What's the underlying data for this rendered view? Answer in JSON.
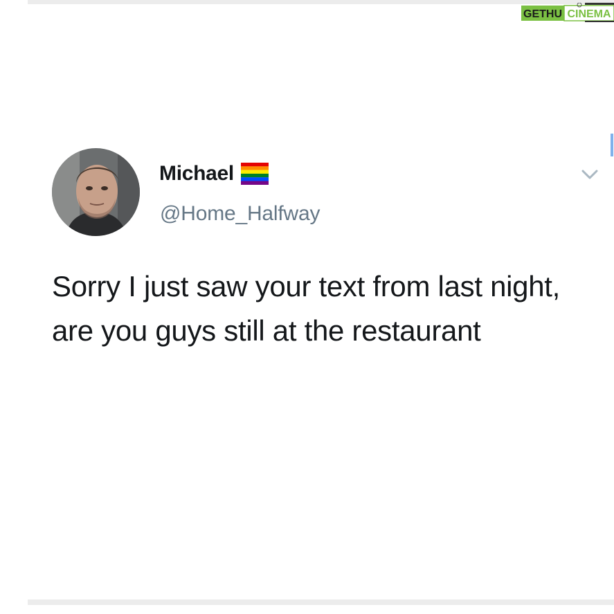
{
  "watermark": {
    "brand_left": "GETHU",
    "brand_right": "CINEMA",
    "color_left": "#7bc043",
    "color_right": "#7bc043"
  },
  "tweet": {
    "display_name": "Michael",
    "name_emoji": "rainbow-flag-icon",
    "handle": "@Home_Halfway",
    "text": "Sorry I just saw your text from last night, are you guys still at the restaurant",
    "menu_icon": "chevron-down-icon"
  },
  "colors": {
    "name": "#14171a",
    "handle": "#657786",
    "caret": "#aab8c2",
    "accent": "#4a90e2"
  }
}
